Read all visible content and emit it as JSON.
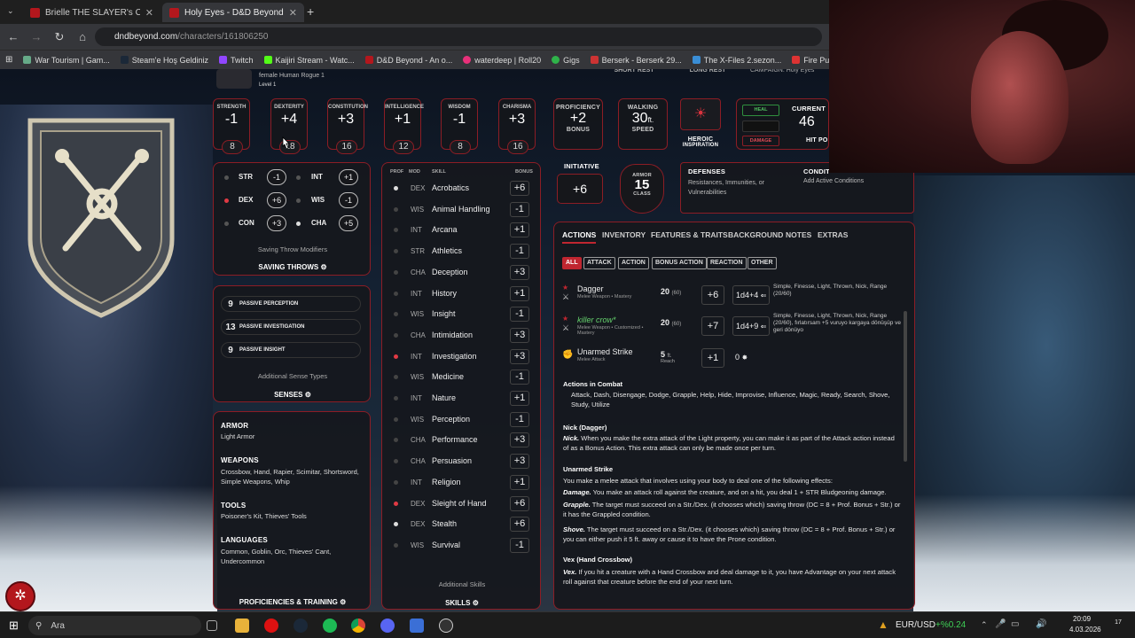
{
  "browser": {
    "tabs": [
      {
        "title": "Brielle THE SLAYER's Character"
      },
      {
        "title": "Holy Eyes - D&D Beyond",
        "active": true
      }
    ],
    "url_host": "dndbeyond.com",
    "url_path": "/characters/161806250",
    "bookmarks": [
      "War Tourism | Gam...",
      "Steam'e Hoş Geldiniz",
      "Twitch",
      "Kaijiri Stream - Watc...",
      "D&D Beyond - An o...",
      "waterdeep | Roll20",
      "Gigs",
      "Berserk - Berserk 29...",
      "The X-Files 2.sezon...",
      "Fire Punch - Bölüm..."
    ]
  },
  "character": {
    "descriptor": "female  Human  Rogue 1",
    "level": "Level 1",
    "short_rest": "SHORT REST",
    "long_rest": "LONG REST",
    "campaign": "CAMPAIGN: Holy Eyes"
  },
  "abilities": [
    {
      "name": "STRENGTH",
      "mod": "-1",
      "score": "8"
    },
    {
      "name": "DEXTERITY",
      "mod": "+4",
      "score": "18"
    },
    {
      "name": "CONSTITUTION",
      "mod": "+3",
      "score": "16"
    },
    {
      "name": "INTELLIGENCE",
      "mod": "+1",
      "score": "12"
    },
    {
      "name": "WISDOM",
      "mod": "-1",
      "score": "8"
    },
    {
      "name": "CHARISMA",
      "mod": "+3",
      "score": "16"
    }
  ],
  "proficiency": {
    "label": "PROFICIENCY",
    "value": "+2",
    "sub": "BONUS"
  },
  "walking": {
    "label": "WALKING",
    "value": "30",
    "unit": "ft.",
    "sub": "SPEED"
  },
  "heroic": {
    "label": "HEROIC",
    "sub": "INSPIRATION"
  },
  "hp": {
    "heal": "HEAL",
    "damage": "DAMAGE",
    "current_label": "CURRENT",
    "current": "46",
    "sub": "HIT PO"
  },
  "initiative": {
    "label": "INITIATIVE",
    "value": "+6"
  },
  "armor": {
    "label": "ARMOR",
    "value": "15",
    "sub": "CLASS"
  },
  "defenses": {
    "title": "DEFENSES",
    "text": "Resistances, Immunities, or Vulnerabilities"
  },
  "conditions": {
    "title": "CONDIT",
    "text": "Add Active Conditions"
  },
  "saving_throws": {
    "items": [
      {
        "abbr": "STR",
        "value": "-1",
        "prof": false
      },
      {
        "abbr": "INT",
        "value": "+1",
        "prof": false
      },
      {
        "abbr": "DEX",
        "value": "+6",
        "prof": true
      },
      {
        "abbr": "WIS",
        "value": "-1",
        "prof": false
      },
      {
        "abbr": "CON",
        "value": "+3",
        "prof": false
      },
      {
        "abbr": "CHA",
        "value": "+5",
        "prof": true
      }
    ],
    "modifiers": "Saving Throw Modifiers",
    "title": "SAVING THROWS"
  },
  "senses": {
    "items": [
      {
        "value": "9",
        "label": "PASSIVE PERCEPTION"
      },
      {
        "value": "13",
        "label": "PASSIVE INVESTIGATION"
      },
      {
        "value": "9",
        "label": "PASSIVE INSIGHT"
      }
    ],
    "additional": "Additional Sense Types",
    "title": "SENSES"
  },
  "proficiencies": {
    "armor_t": "ARMOR",
    "armor": "Light Armor",
    "weapons_t": "WEAPONS",
    "weapons": "Crossbow, Hand, Rapier, Scimitar, Shortsword, Simple Weapons, Whip",
    "tools_t": "TOOLS",
    "tools": "Poisoner's Kit, Thieves' Tools",
    "languages_t": "LANGUAGES",
    "languages": "Common, Goblin, Orc, Thieves' Cant, Undercommon",
    "title": "PROFICIENCIES & TRAINING"
  },
  "skills": {
    "headers": {
      "prof": "PROF",
      "mod": "MOD",
      "skill": "SKILL",
      "bonus": "BONUS"
    },
    "items": [
      {
        "mod": "DEX",
        "name": "Acrobatics",
        "bonus": "+6",
        "p": "exp"
      },
      {
        "mod": "WIS",
        "name": "Animal Handling",
        "bonus": "-1",
        "p": "none"
      },
      {
        "mod": "INT",
        "name": "Arcana",
        "bonus": "+1",
        "p": "none"
      },
      {
        "mod": "STR",
        "name": "Athletics",
        "bonus": "-1",
        "p": "none"
      },
      {
        "mod": "CHA",
        "name": "Deception",
        "bonus": "+3",
        "p": "none"
      },
      {
        "mod": "INT",
        "name": "History",
        "bonus": "+1",
        "p": "none"
      },
      {
        "mod": "WIS",
        "name": "Insight",
        "bonus": "-1",
        "p": "none"
      },
      {
        "mod": "CHA",
        "name": "Intimidation",
        "bonus": "+3",
        "p": "none"
      },
      {
        "mod": "INT",
        "name": "Investigation",
        "bonus": "+3",
        "p": "prof"
      },
      {
        "mod": "WIS",
        "name": "Medicine",
        "bonus": "-1",
        "p": "none"
      },
      {
        "mod": "INT",
        "name": "Nature",
        "bonus": "+1",
        "p": "none"
      },
      {
        "mod": "WIS",
        "name": "Perception",
        "bonus": "-1",
        "p": "none"
      },
      {
        "mod": "CHA",
        "name": "Performance",
        "bonus": "+3",
        "p": "none"
      },
      {
        "mod": "CHA",
        "name": "Persuasion",
        "bonus": "+3",
        "p": "none"
      },
      {
        "mod": "INT",
        "name": "Religion",
        "bonus": "+1",
        "p": "none"
      },
      {
        "mod": "DEX",
        "name": "Sleight of Hand",
        "bonus": "+6",
        "p": "prof"
      },
      {
        "mod": "DEX",
        "name": "Stealth",
        "bonus": "+6",
        "p": "exp"
      },
      {
        "mod": "WIS",
        "name": "Survival",
        "bonus": "-1",
        "p": "none"
      }
    ],
    "additional": "Additional Skills",
    "title": "SKILLS"
  },
  "actions": {
    "tabs": [
      "ACTIONS",
      "INVENTORY",
      "FEATURES & TRAITS",
      "BACKGROUND",
      "NOTES",
      "EXTRAS"
    ],
    "filters": [
      "ALL",
      "ATTACK",
      "ACTION",
      "BONUS ACTION",
      "REACTION",
      "OTHER"
    ],
    "attacks": [
      {
        "name": "Dagger",
        "sub": "Melee Weapon • Mastery",
        "range": "20",
        "range2": "(60)",
        "hit": "+6",
        "damage": "1d4+4",
        "notes": "Simple, Finesse, Light, Thrown, Nick, Range (20/60)"
      },
      {
        "name": "killer crow*",
        "sub": "Melee Weapon • Customized • Mastery",
        "range": "20",
        "range2": "(60)",
        "hit": "+7",
        "damage": "1d4+9",
        "notes": "Simple, Finesse, Light, Thrown, Nick, Range (20/60), fırlatırsam +5 vuruyo kargaya dönüşüp ve geri dönüyo"
      },
      {
        "name": "Unarmed Strike",
        "sub": "Melee Attack",
        "range": "5",
        "range2": "ft.",
        "range3": "Reach",
        "hit": "+1",
        "damage": "0",
        "notes": ""
      }
    ],
    "combat_title": "Actions in Combat",
    "combat_text": "Attack, Dash, Disengage, Dodge, Grapple, Help, Hide, Improvise, Influence, Magic, Ready, Search, Shove, Study, Utilize",
    "nick_title": "Nick (Dagger)",
    "nick_lead": "Nick.",
    "nick_text": " When you make the extra attack of the Light property, you can make it as part of the Attack action instead of as a Bonus Action. This extra attack can only be made once per turn.",
    "unarmed_title": "Unarmed Strike",
    "unarmed_text": "You make a melee attack that involves using your body to deal one of the following effects:",
    "damage_lead": "Damage.",
    "damage_text": " You make an attack roll against the creature, and on a hit, you deal 1 + STR Bludgeoning damage.",
    "grapple_lead": "Grapple.",
    "grapple_text": " The target must succeed on a Str./Dex. (it chooses which) saving throw (DC = 8 + Prof. Bonus + Str.) or it has the Grappled condition.",
    "shove_lead": "Shove.",
    "shove_text": " The target must succeed on a Str./Dex. (it chooses which) saving throw (DC = 8 + Prof. Bonus + Str.) or you can either push it 5 ft. away or cause it to have the Prone condition.",
    "vex_title": "Vex (Hand Crossbow)",
    "vex_lead": "Vex.",
    "vex_text": " If you hit a creature with a Hand Crossbow and deal damage to it, you have Advantage on your next attack roll against that creature before the end of your next turn."
  },
  "taskbar": {
    "search": "Ara",
    "ticker": "EUR/USD",
    "change": "+%0.24",
    "time": "20:09",
    "date": "4.03.2026",
    "notif": "17"
  }
}
